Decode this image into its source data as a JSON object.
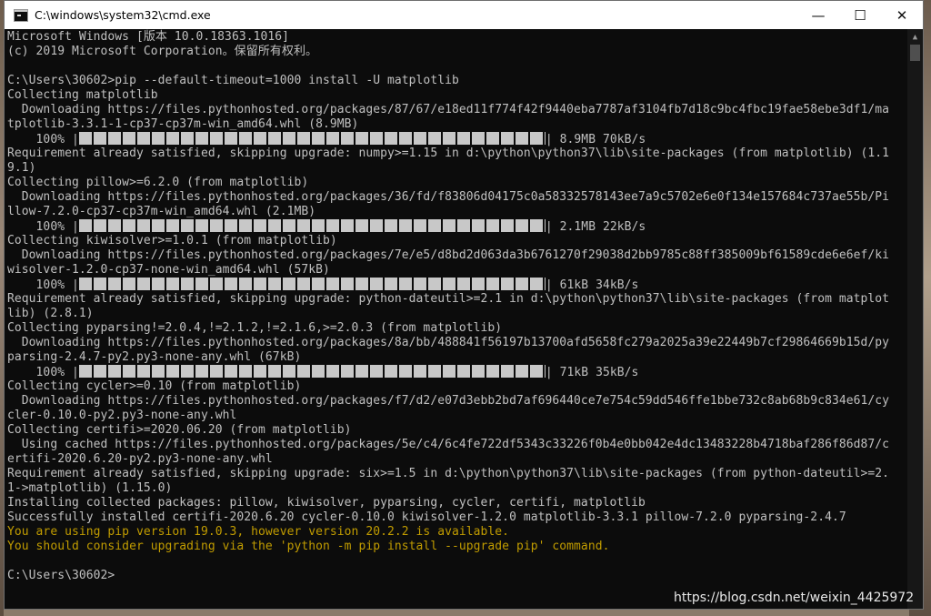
{
  "window": {
    "title": "C:\\windows\\system32\\cmd.exe",
    "controls": {
      "minimize": "—",
      "maximize": "☐",
      "close": "✕"
    }
  },
  "console": {
    "lines": [
      {
        "text": "Microsoft Windows [版本 10.0.18363.1016]"
      },
      {
        "text": "(c) 2019 Microsoft Corporation。保留所有权利。"
      },
      {
        "text": ""
      },
      {
        "text": "C:\\Users\\30602>pip --default-timeout=1000 install -U matplotlib"
      },
      {
        "text": "Collecting matplotlib"
      },
      {
        "text": "  Downloading https://files.pythonhosted.org/packages/87/67/e18ed11f774f42f9440eba7787af3104fb7d18c9bc4fbc19fae58ebe3df1/ma"
      },
      {
        "text": "tplotlib-3.3.1-1-cp37-cp37m-win_amd64.whl (8.9MB)"
      },
      {
        "pct": "    100% |",
        "bar": true,
        "end": "| 8.9MB 70kB/s"
      },
      {
        "text": "Requirement already satisfied, skipping upgrade: numpy>=1.15 in d:\\python\\python37\\lib\\site-packages (from matplotlib) (1.1"
      },
      {
        "text": "9.1)"
      },
      {
        "text": "Collecting pillow>=6.2.0 (from matplotlib)"
      },
      {
        "text": "  Downloading https://files.pythonhosted.org/packages/36/fd/f83806d04175c0a58332578143ee7a9c5702e6e0f134e157684c737ae55b/Pi"
      },
      {
        "text": "llow-7.2.0-cp37-cp37m-win_amd64.whl (2.1MB)"
      },
      {
        "pct": "    100% |",
        "bar": true,
        "end": "| 2.1MB 22kB/s"
      },
      {
        "text": "Collecting kiwisolver>=1.0.1 (from matplotlib)"
      },
      {
        "text": "  Downloading https://files.pythonhosted.org/packages/7e/e5/d8bd2d063da3b6761270f29038d2bb9785c88ff385009bf61589cde6e6ef/ki"
      },
      {
        "text": "wisolver-1.2.0-cp37-none-win_amd64.whl (57kB)"
      },
      {
        "pct": "    100% |",
        "bar": true,
        "end": "| 61kB 34kB/s"
      },
      {
        "text": "Requirement already satisfied, skipping upgrade: python-dateutil>=2.1 in d:\\python\\python37\\lib\\site-packages (from matplot"
      },
      {
        "text": "lib) (2.8.1)"
      },
      {
        "text": "Collecting pyparsing!=2.0.4,!=2.1.2,!=2.1.6,>=2.0.3 (from matplotlib)"
      },
      {
        "text": "  Downloading https://files.pythonhosted.org/packages/8a/bb/488841f56197b13700afd5658fc279a2025a39e22449b7cf29864669b15d/py"
      },
      {
        "text": "parsing-2.4.7-py2.py3-none-any.whl (67kB)"
      },
      {
        "pct": "    100% |",
        "bar": true,
        "end": "| 71kB 35kB/s"
      },
      {
        "text": "Collecting cycler>=0.10 (from matplotlib)"
      },
      {
        "text": "  Downloading https://files.pythonhosted.org/packages/f7/d2/e07d3ebb2bd7af696440ce7e754c59dd546ffe1bbe732c8ab68b9c834e61/cy"
      },
      {
        "text": "cler-0.10.0-py2.py3-none-any.whl"
      },
      {
        "text": "Collecting certifi>=2020.06.20 (from matplotlib)"
      },
      {
        "text": "  Using cached https://files.pythonhosted.org/packages/5e/c4/6c4fe722df5343c33226f0b4e0bb042e4dc13483228b4718baf286f86d87/c"
      },
      {
        "text": "ertifi-2020.6.20-py2.py3-none-any.whl"
      },
      {
        "text": "Requirement already satisfied, skipping upgrade: six>=1.5 in d:\\python\\python37\\lib\\site-packages (from python-dateutil>=2."
      },
      {
        "text": "1->matplotlib) (1.15.0)"
      },
      {
        "text": "Installing collected packages: pillow, kiwisolver, pyparsing, cycler, certifi, matplotlib"
      },
      {
        "text": "Successfully installed certifi-2020.6.20 cycler-0.10.0 kiwisolver-1.2.0 matplotlib-3.3.1 pillow-7.2.0 pyparsing-2.4.7"
      },
      {
        "text": "You are using pip version 19.0.3, however version 20.2.2 is available.",
        "color": "yellow"
      },
      {
        "text": "You should consider upgrading via the 'python -m pip install --upgrade pip' command.",
        "color": "yellow"
      },
      {
        "text": ""
      },
      {
        "text": "C:\\Users\\30602>"
      }
    ]
  },
  "watermark": "https://blog.csdn.net/weixin_4425972",
  "colors": {
    "console_bg": "#0c0c0c",
    "console_fg": "#c0c0c0",
    "warning": "#c19c00"
  }
}
